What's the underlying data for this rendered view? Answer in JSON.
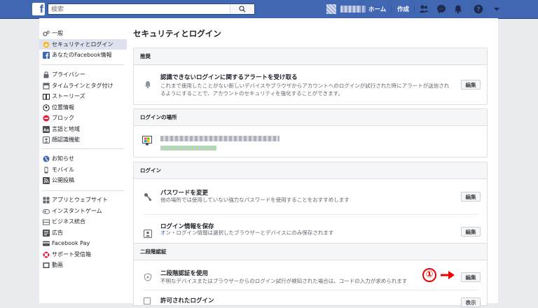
{
  "topbar": {
    "logo": "f",
    "search_placeholder": "検索",
    "home_label": "ホーム",
    "create_label": "作成",
    "icons": [
      "friends-icon",
      "messenger-icon",
      "notifications-icon",
      "help-icon",
      "account-menu-icon"
    ]
  },
  "colors": {
    "brand": "#4267b2",
    "accent_text": "#4267b2",
    "annotation": "#e00000"
  },
  "sidebar": {
    "groups": [
      {
        "items": [
          {
            "label": "一般",
            "icon": "gear-icon"
          },
          {
            "label": "セキュリティとログイン",
            "icon": "shield-icon",
            "active": true
          },
          {
            "label": "あなたのFacebook情報",
            "icon": "facebook-icon"
          }
        ]
      },
      {
        "items": [
          {
            "label": "プライバシー",
            "icon": "lock-icon"
          },
          {
            "label": "タイムラインとタグ付け",
            "icon": "timeline-icon"
          },
          {
            "label": "ストーリーズ",
            "icon": "book-icon"
          },
          {
            "label": "位置情報",
            "icon": "location-icon"
          },
          {
            "label": "ブロック",
            "icon": "block-icon"
          },
          {
            "label": "言語と地域",
            "icon": "language-icon"
          },
          {
            "label": "顔認識機能",
            "icon": "face-icon"
          }
        ]
      },
      {
        "items": [
          {
            "label": "お知らせ",
            "icon": "globe-icon"
          },
          {
            "label": "モバイル",
            "icon": "mobile-icon"
          },
          {
            "label": "公開投稿",
            "icon": "rss-icon"
          }
        ]
      },
      {
        "items": [
          {
            "label": "アプリとウェブサイト",
            "icon": "apps-icon"
          },
          {
            "label": "インスタントゲーム",
            "icon": "gamepad-icon"
          },
          {
            "label": "ビジネス統合",
            "icon": "business-icon"
          },
          {
            "label": "広告",
            "icon": "ads-icon"
          },
          {
            "label": "Facebook Pay",
            "icon": "card-icon"
          },
          {
            "label": "サポート受信箱",
            "icon": "lifebuoy-icon"
          },
          {
            "label": "動画",
            "icon": "video-icon"
          }
        ]
      }
    ]
  },
  "main": {
    "title": "セキュリティとログイン",
    "sections": {
      "recommended": {
        "header": "推奨",
        "alert": {
          "title": "認識できないログインに関するアラートを受け取る",
          "desc": "これまで使用したことがない新しいデバイスやブラウザからアカウントへのログインが試行された時にアラートが送信されるようにすることで、アカウントのセキュリティを強化することができます。",
          "button": "編集"
        }
      },
      "where_logged_in": {
        "header": "ログインの場所"
      },
      "login": {
        "header": "ログイン",
        "password": {
          "title": "パスワードを変更",
          "desc": "他の場所では使用していない強力なパスワードを使用することをおすすめします",
          "button": "編集"
        },
        "save_login": {
          "title": "ログイン情報を保存",
          "status": "オン",
          "desc": "・ログイン情報は選択したブラウザーとデバイスにのみ保存されます",
          "button": "編集"
        }
      },
      "two_factor": {
        "header": "二段階認証",
        "use_2fa": {
          "title": "二段階認証を使用",
          "desc": "不明なデバイスまたはブラウザーからのログイン試行が検知された場合は、コードの入力が求められます",
          "button": "編集"
        },
        "authorized": {
          "title": "許可されたログイン",
          "button": "表示"
        }
      }
    }
  },
  "annotation": {
    "number": "①"
  }
}
